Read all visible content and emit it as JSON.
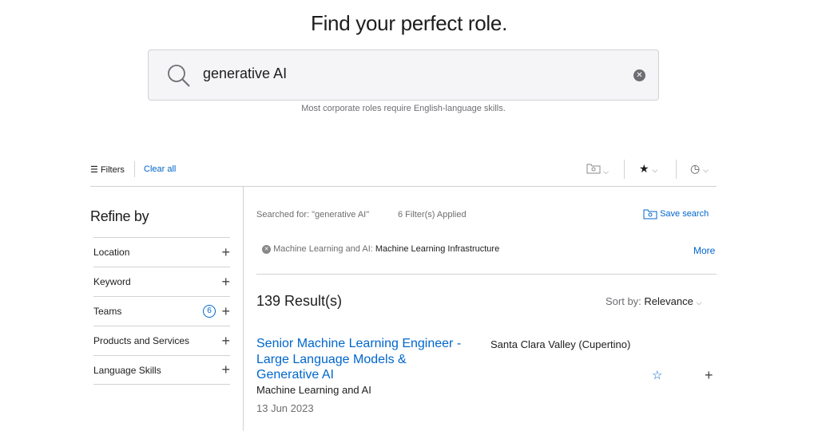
{
  "header": {
    "title": "Find your perfect role."
  },
  "search": {
    "value": "generative AI",
    "hint": "Most corporate roles require English-language skills."
  },
  "toolbar": {
    "filters_label": "Filters",
    "clear_all": "Clear all"
  },
  "sidebar": {
    "title": "Refine by",
    "items": [
      {
        "label": "Location"
      },
      {
        "label": "Keyword"
      },
      {
        "label": "Teams",
        "badge": "6"
      },
      {
        "label": "Products and Services"
      },
      {
        "label": "Language Skills"
      }
    ]
  },
  "main": {
    "searched_for": "Searched for: \"generative AI\"",
    "filters_applied": "6 Filter(s) Applied",
    "save_search": "Save search",
    "chip": {
      "category": "Machine Learning and AI:",
      "value": "Machine Learning Infrastructure"
    },
    "more": "More",
    "results_count": "139 Result(s)",
    "sort_label": "Sort by:",
    "sort_value": "Relevance",
    "jobs": [
      {
        "title": "Senior Machine Learning Engineer - Large Language Models & Generative AI",
        "team": "Machine Learning and AI",
        "date": "13 Jun 2023",
        "location": "Santa Clara Valley (Cupertino)"
      }
    ]
  },
  "colors": {
    "accent": "#0066cc"
  }
}
